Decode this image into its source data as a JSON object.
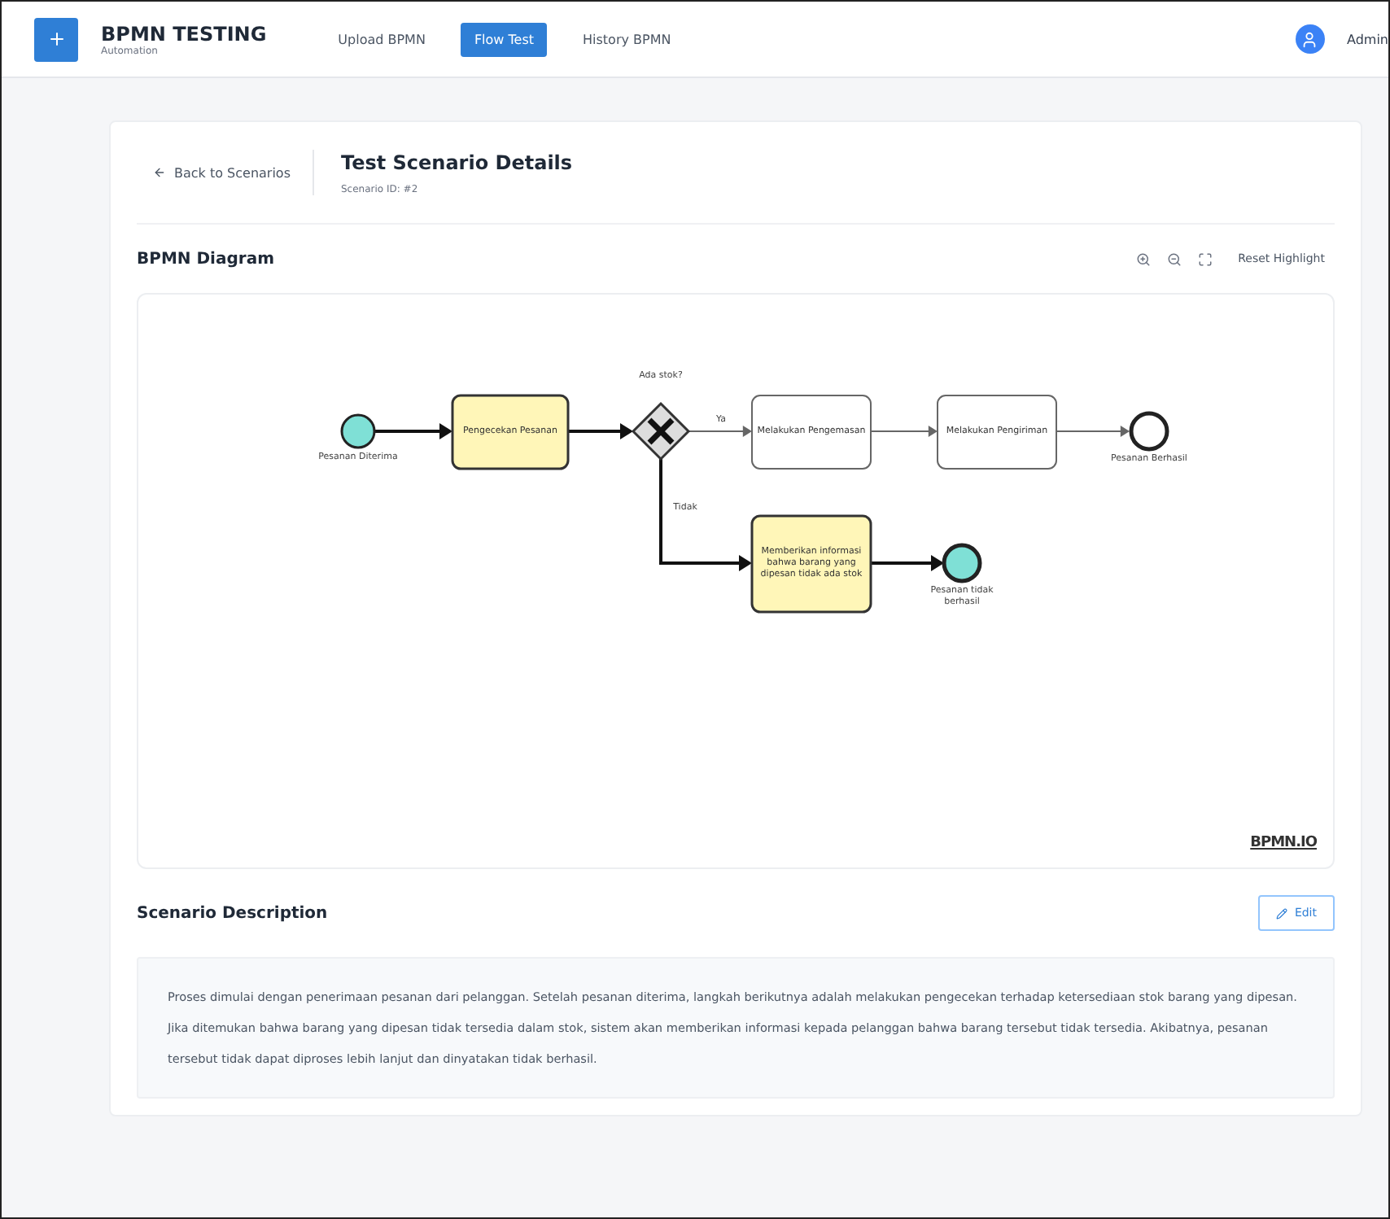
{
  "app": {
    "title": "BPMN TESTING",
    "subtitle": "Automation"
  },
  "nav": [
    {
      "label": "Upload BPMN",
      "selected": false
    },
    {
      "label": "Flow Test",
      "selected": true
    },
    {
      "label": "History BPMN",
      "selected": false
    }
  ],
  "user": {
    "name": "Admin"
  },
  "back_link": "Back to Scenarios",
  "page": {
    "title": "Test Scenario Details",
    "subtitle": "Scenario ID: #2"
  },
  "diagram": {
    "title": "BPMN Diagram",
    "reset_button": "Reset Highlight",
    "brand": "BPMN.IO",
    "nodes": [
      {
        "kind": "start",
        "label": "Pesanan Diterima",
        "highlighted": true
      },
      {
        "kind": "task",
        "label": "Pengecekan Pesanan",
        "highlighted": true
      },
      {
        "kind": "gateway",
        "label": "Ada stok?",
        "highlighted": true
      },
      {
        "kind": "task",
        "label": "Melakukan Pengemasan",
        "highlighted": false
      },
      {
        "kind": "task",
        "label": "Melakukan Pengiriman",
        "highlighted": false
      },
      {
        "kind": "end",
        "label": "Pesanan Berhasil",
        "highlighted": false
      },
      {
        "kind": "task",
        "label": "Memberikan informasi bahwa barang yang dipesan tidak ada stok",
        "highlighted": true
      },
      {
        "kind": "end",
        "label": "Pesanan tidak berhasil",
        "highlighted": true
      }
    ],
    "edges": [
      {
        "highlighted": true
      },
      {
        "highlighted": true
      },
      {
        "label": "Ya",
        "highlighted": false
      },
      {
        "highlighted": false
      },
      {
        "highlighted": false
      },
      {
        "label": "Tidak",
        "highlighted": true
      },
      {
        "highlighted": true
      }
    ]
  },
  "description": {
    "title": "Scenario Description",
    "edit_button": "Edit",
    "text": "Proses dimulai dengan penerimaan pesanan dari pelanggan. Setelah pesanan diterima, langkah berikutnya adalah melakukan pengecekan terhadap ketersediaan stok barang yang dipesan. Jika ditemukan bahwa barang yang dipesan tidak tersedia dalam stok, sistem akan memberikan informasi kepada pelanggan bahwa barang tersebut tidak tersedia. Akibatnya, pesanan tersebut tidak dapat diproses lebih lanjut dan dinyatakan tidak berhasil."
  }
}
